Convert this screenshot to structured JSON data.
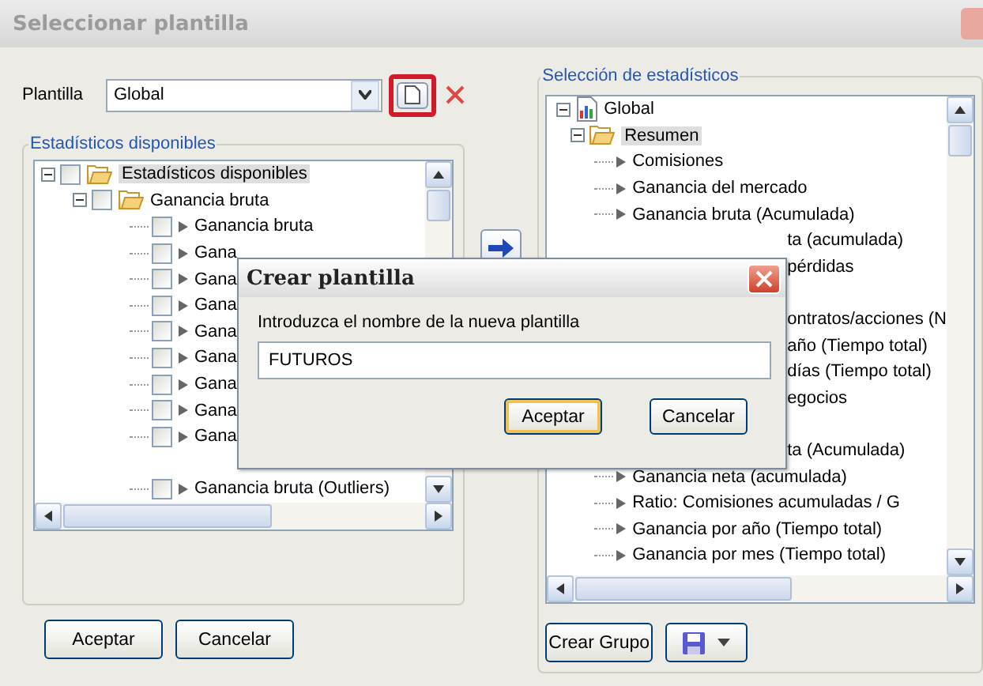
{
  "window": {
    "title": "Seleccionar plantilla"
  },
  "template": {
    "label": "Plantilla",
    "value": "Global"
  },
  "available": {
    "title": "Estadísticos disponibles",
    "tree": [
      {
        "label": "Estadísticos disponibles",
        "checked": false,
        "expanded": true,
        "selected": true,
        "children": [
          {
            "label": "Ganancia bruta",
            "checked": false,
            "expanded": true,
            "selected": false,
            "children": [
              {
                "kind": "leaf",
                "label": "Ganancia bruta",
                "checked": false,
                "selected": false
              },
              {
                "kind": "leaf",
                "label": "Gana",
                "checked": false,
                "selected": false
              },
              {
                "kind": "leaf",
                "label": "Gana",
                "checked": false,
                "selected": false
              },
              {
                "kind": "leaf",
                "label": "Gana",
                "checked": false,
                "selected": false
              },
              {
                "kind": "leaf",
                "label": "Gana",
                "checked": false,
                "selected": false
              },
              {
                "kind": "leaf",
                "label": "Gana",
                "checked": false,
                "selected": false
              },
              {
                "kind": "leaf",
                "label": "Gana",
                "checked": false,
                "selected": false
              },
              {
                "kind": "leaf",
                "label": "Gana",
                "checked": false,
                "selected": false
              },
              {
                "kind": "leaf",
                "label": "Gana",
                "checked": false,
                "selected": false
              },
              {
                "kind": "covered"
              },
              {
                "kind": "leaf",
                "label": "Ganancia bruta (Outliers)",
                "checked": false,
                "selected": false
              }
            ]
          }
        ]
      }
    ]
  },
  "buttons": [
    "Aceptar",
    "Cancelar"
  ],
  "selection": {
    "title": "Selección de estadísticos",
    "tree": [
      {
        "label": "Global",
        "expanded": true,
        "selected": false,
        "children": [
          {
            "label": "Resumen",
            "expanded": true,
            "selected": true,
            "children": [
              {
                "kind": "leaf",
                "label": "Comisiones",
                "selected": false
              },
              {
                "kind": "leaf",
                "label": "Ganancia del mercado",
                "selected": false
              },
              {
                "kind": "leaf",
                "label": "Ganancia bruta (Acumulada)",
                "selected": false
              },
              {
                "kind": "clipped",
                "label": "ta (acumulada)",
                "selected": false
              },
              {
                "kind": "clipped",
                "label": "pérdidas",
                "selected": false
              },
              {
                "kind": "covered",
                "selected": false
              },
              {
                "kind": "clipped",
                "label": "ontratos/acciones (N",
                "selected": false
              },
              {
                "kind": "clipped",
                "label": "año (Tiempo total)",
                "selected": false
              },
              {
                "kind": "clipped",
                "label": "días (Tiempo total)",
                "selected": false
              },
              {
                "kind": "clipped",
                "label": "egocios",
                "selected": false
              },
              {
                "kind": "covered",
                "selected": false
              },
              {
                "kind": "clipped",
                "label": "ta (Acumulada)",
                "selected": false
              },
              {
                "kind": "leaf",
                "label": "Ganancia neta (acumulada)",
                "selected": false
              },
              {
                "kind": "leaf",
                "label": "Ratio: Comisiones acumuladas / G",
                "selected": false
              },
              {
                "kind": "leaf",
                "label": "Ganancia por año (Tiempo total)",
                "selected": false
              },
              {
                "kind": "leaf",
                "label": "Ganancia por mes (Tiempo total)",
                "selected": false
              }
            ]
          }
        ]
      }
    ]
  },
  "selection_buttons": {
    "create_group": "Crear Grupo"
  },
  "dialog": {
    "title": "Crear plantilla",
    "prompt": "Introduzca el nombre de la nueva plantilla",
    "value": "FUTUROS",
    "buttons": [
      {
        "label": "Aceptar",
        "default": true
      },
      {
        "label": "Cancelar",
        "default": false
      }
    ]
  }
}
